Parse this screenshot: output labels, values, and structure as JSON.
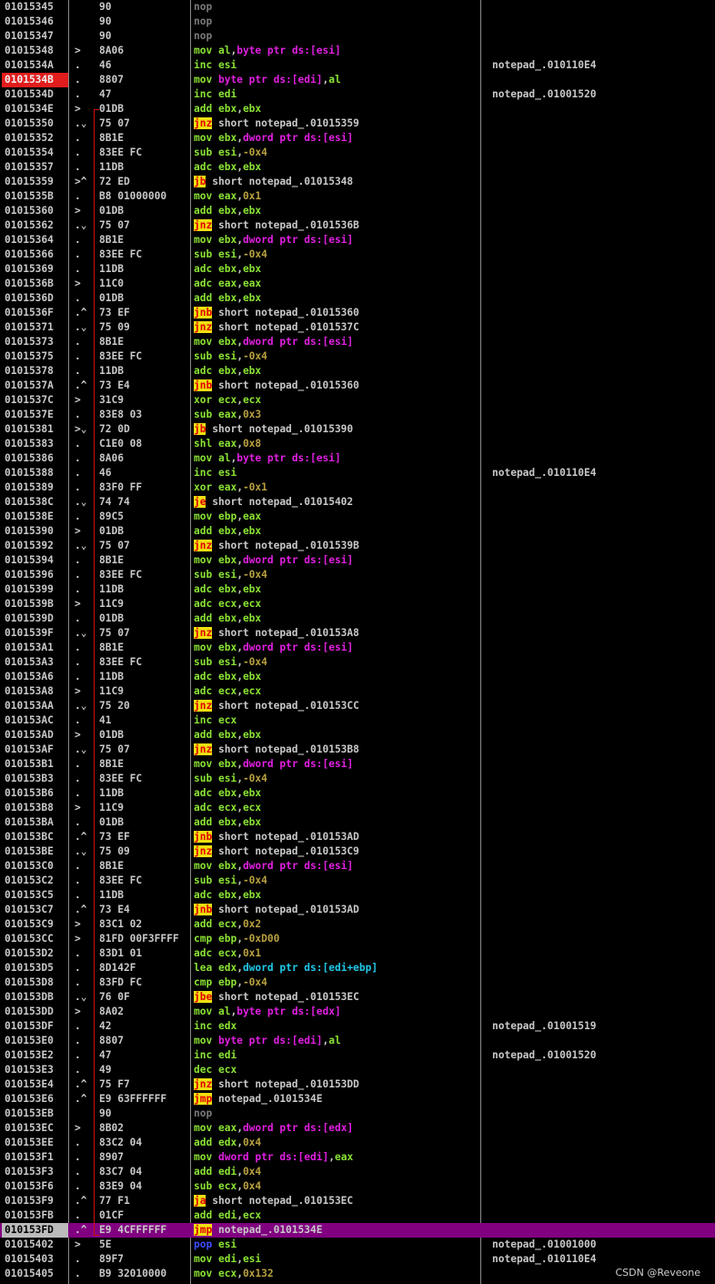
{
  "watermark": "CSDN @Reveone",
  "rows": [
    {
      "addr": "01015345",
      "arrow": "",
      "bytes": "90",
      "mn": "nop",
      "args": "",
      "cmt": ""
    },
    {
      "addr": "01015346",
      "arrow": "",
      "bytes": "90",
      "mn": "nop",
      "args": "",
      "cmt": ""
    },
    {
      "addr": "01015347",
      "arrow": "",
      "bytes": "90",
      "mn": "nop",
      "args": "",
      "cmt": ""
    },
    {
      "addr": "01015348",
      "arrow": ">",
      "bytes": "8A06",
      "mn": "mov",
      "args": "al,byte ptr ds:[esi]",
      "cmt": ""
    },
    {
      "addr": "0101534A",
      "arrow": ".",
      "bytes": "46",
      "mn": "inc",
      "args": "esi",
      "cmt": "notepad_.010110E4"
    },
    {
      "addr": "0101534B",
      "arrow": ".",
      "bytes": "8807",
      "mn": "mov",
      "args": "byte ptr ds:[edi],al",
      "cmt": "",
      "eip": true
    },
    {
      "addr": "0101534D",
      "arrow": ".",
      "bytes": "47",
      "mn": "inc",
      "args": "edi",
      "cmt": "notepad_.01001520"
    },
    {
      "addr": "0101534E",
      "arrow": ">",
      "bytes": "01DB",
      "mn": "add",
      "args": "ebx,ebx",
      "cmt": ""
    },
    {
      "addr": "01015350",
      "arrow": ".⌄",
      "bytes": "75 07",
      "mn": "jnz",
      "args": "short notepad_.01015359",
      "cmt": ""
    },
    {
      "addr": "01015352",
      "arrow": ".",
      "bytes": "8B1E",
      "mn": "mov",
      "args": "ebx,dword ptr ds:[esi]",
      "cmt": ""
    },
    {
      "addr": "01015354",
      "arrow": ".",
      "bytes": "83EE FC",
      "mn": "sub",
      "args": "esi,-0x4",
      "cmt": ""
    },
    {
      "addr": "01015357",
      "arrow": ".",
      "bytes": "11DB",
      "mn": "adc",
      "args": "ebx,ebx",
      "cmt": ""
    },
    {
      "addr": "01015359",
      "arrow": ">^",
      "bytes": "72 ED",
      "mn": "jb",
      "args": "short notepad_.01015348",
      "cmt": ""
    },
    {
      "addr": "0101535B",
      "arrow": ".",
      "bytes": "B8 01000000",
      "mn": "mov",
      "args": "eax,0x1",
      "cmt": ""
    },
    {
      "addr": "01015360",
      "arrow": ">",
      "bytes": "01DB",
      "mn": "add",
      "args": "ebx,ebx",
      "cmt": ""
    },
    {
      "addr": "01015362",
      "arrow": ".⌄",
      "bytes": "75 07",
      "mn": "jnz",
      "args": "short notepad_.0101536B",
      "cmt": ""
    },
    {
      "addr": "01015364",
      "arrow": ".",
      "bytes": "8B1E",
      "mn": "mov",
      "args": "ebx,dword ptr ds:[esi]",
      "cmt": ""
    },
    {
      "addr": "01015366",
      "arrow": ".",
      "bytes": "83EE FC",
      "mn": "sub",
      "args": "esi,-0x4",
      "cmt": ""
    },
    {
      "addr": "01015369",
      "arrow": ".",
      "bytes": "11DB",
      "mn": "adc",
      "args": "ebx,ebx",
      "cmt": ""
    },
    {
      "addr": "0101536B",
      "arrow": ">",
      "bytes": "11C0",
      "mn": "adc",
      "args": "eax,eax",
      "cmt": ""
    },
    {
      "addr": "0101536D",
      "arrow": ".",
      "bytes": "01DB",
      "mn": "add",
      "args": "ebx,ebx",
      "cmt": ""
    },
    {
      "addr": "0101536F",
      "arrow": ".^",
      "bytes": "73 EF",
      "mn": "jnb",
      "args": "short notepad_.01015360",
      "cmt": ""
    },
    {
      "addr": "01015371",
      "arrow": ".⌄",
      "bytes": "75 09",
      "mn": "jnz",
      "args": "short notepad_.0101537C",
      "cmt": ""
    },
    {
      "addr": "01015373",
      "arrow": ".",
      "bytes": "8B1E",
      "mn": "mov",
      "args": "ebx,dword ptr ds:[esi]",
      "cmt": ""
    },
    {
      "addr": "01015375",
      "arrow": ".",
      "bytes": "83EE FC",
      "mn": "sub",
      "args": "esi,-0x4",
      "cmt": ""
    },
    {
      "addr": "01015378",
      "arrow": ".",
      "bytes": "11DB",
      "mn": "adc",
      "args": "ebx,ebx",
      "cmt": ""
    },
    {
      "addr": "0101537A",
      "arrow": ".^",
      "bytes": "73 E4",
      "mn": "jnb",
      "args": "short notepad_.01015360",
      "cmt": ""
    },
    {
      "addr": "0101537C",
      "arrow": ">",
      "bytes": "31C9",
      "mn": "xor",
      "args": "ecx,ecx",
      "cmt": ""
    },
    {
      "addr": "0101537E",
      "arrow": ".",
      "bytes": "83E8 03",
      "mn": "sub",
      "args": "eax,0x3",
      "cmt": ""
    },
    {
      "addr": "01015381",
      "arrow": ">⌄",
      "bytes": "72 0D",
      "mn": "jb",
      "args": "short notepad_.01015390",
      "cmt": ""
    },
    {
      "addr": "01015383",
      "arrow": ".",
      "bytes": "C1E0 08",
      "mn": "shl",
      "args": "eax,0x8",
      "cmt": ""
    },
    {
      "addr": "01015386",
      "arrow": ".",
      "bytes": "8A06",
      "mn": "mov",
      "args": "al,byte ptr ds:[esi]",
      "cmt": ""
    },
    {
      "addr": "01015388",
      "arrow": ".",
      "bytes": "46",
      "mn": "inc",
      "args": "esi",
      "cmt": "notepad_.010110E4"
    },
    {
      "addr": "01015389",
      "arrow": ".",
      "bytes": "83F0 FF",
      "mn": "xor",
      "args": "eax,-0x1",
      "cmt": ""
    },
    {
      "addr": "0101538C",
      "arrow": ".⌄",
      "bytes": "74 74",
      "mn": "je",
      "args": "short notepad_.01015402",
      "cmt": ""
    },
    {
      "addr": "0101538E",
      "arrow": ".",
      "bytes": "89C5",
      "mn": "mov",
      "args": "ebp,eax",
      "cmt": ""
    },
    {
      "addr": "01015390",
      "arrow": ">",
      "bytes": "01DB",
      "mn": "add",
      "args": "ebx,ebx",
      "cmt": ""
    },
    {
      "addr": "01015392",
      "arrow": ".⌄",
      "bytes": "75 07",
      "mn": "jnz",
      "args": "short notepad_.0101539B",
      "cmt": ""
    },
    {
      "addr": "01015394",
      "arrow": ".",
      "bytes": "8B1E",
      "mn": "mov",
      "args": "ebx,dword ptr ds:[esi]",
      "cmt": ""
    },
    {
      "addr": "01015396",
      "arrow": ".",
      "bytes": "83EE FC",
      "mn": "sub",
      "args": "esi,-0x4",
      "cmt": ""
    },
    {
      "addr": "01015399",
      "arrow": ".",
      "bytes": "11DB",
      "mn": "adc",
      "args": "ebx,ebx",
      "cmt": ""
    },
    {
      "addr": "0101539B",
      "arrow": ">",
      "bytes": "11C9",
      "mn": "adc",
      "args": "ecx,ecx",
      "cmt": ""
    },
    {
      "addr": "0101539D",
      "arrow": ".",
      "bytes": "01DB",
      "mn": "add",
      "args": "ebx,ebx",
      "cmt": ""
    },
    {
      "addr": "0101539F",
      "arrow": ".⌄",
      "bytes": "75 07",
      "mn": "jnz",
      "args": "short notepad_.010153A8",
      "cmt": ""
    },
    {
      "addr": "010153A1",
      "arrow": ".",
      "bytes": "8B1E",
      "mn": "mov",
      "args": "ebx,dword ptr ds:[esi]",
      "cmt": ""
    },
    {
      "addr": "010153A3",
      "arrow": ".",
      "bytes": "83EE FC",
      "mn": "sub",
      "args": "esi,-0x4",
      "cmt": ""
    },
    {
      "addr": "010153A6",
      "arrow": ".",
      "bytes": "11DB",
      "mn": "adc",
      "args": "ebx,ebx",
      "cmt": ""
    },
    {
      "addr": "010153A8",
      "arrow": ">",
      "bytes": "11C9",
      "mn": "adc",
      "args": "ecx,ecx",
      "cmt": ""
    },
    {
      "addr": "010153AA",
      "arrow": ".⌄",
      "bytes": "75 20",
      "mn": "jnz",
      "args": "short notepad_.010153CC",
      "cmt": ""
    },
    {
      "addr": "010153AC",
      "arrow": ".",
      "bytes": "41",
      "mn": "inc",
      "args": "ecx",
      "cmt": ""
    },
    {
      "addr": "010153AD",
      "arrow": ">",
      "bytes": "01DB",
      "mn": "add",
      "args": "ebx,ebx",
      "cmt": ""
    },
    {
      "addr": "010153AF",
      "arrow": ".⌄",
      "bytes": "75 07",
      "mn": "jnz",
      "args": "short notepad_.010153B8",
      "cmt": ""
    },
    {
      "addr": "010153B1",
      "arrow": ".",
      "bytes": "8B1E",
      "mn": "mov",
      "args": "ebx,dword ptr ds:[esi]",
      "cmt": ""
    },
    {
      "addr": "010153B3",
      "arrow": ".",
      "bytes": "83EE FC",
      "mn": "sub",
      "args": "esi,-0x4",
      "cmt": ""
    },
    {
      "addr": "010153B6",
      "arrow": ".",
      "bytes": "11DB",
      "mn": "adc",
      "args": "ebx,ebx",
      "cmt": ""
    },
    {
      "addr": "010153B8",
      "arrow": ">",
      "bytes": "11C9",
      "mn": "adc",
      "args": "ecx,ecx",
      "cmt": ""
    },
    {
      "addr": "010153BA",
      "arrow": ".",
      "bytes": "01DB",
      "mn": "add",
      "args": "ebx,ebx",
      "cmt": ""
    },
    {
      "addr": "010153BC",
      "arrow": ".^",
      "bytes": "73 EF",
      "mn": "jnb",
      "args": "short notepad_.010153AD",
      "cmt": ""
    },
    {
      "addr": "010153BE",
      "arrow": ".⌄",
      "bytes": "75 09",
      "mn": "jnz",
      "args": "short notepad_.010153C9",
      "cmt": ""
    },
    {
      "addr": "010153C0",
      "arrow": ".",
      "bytes": "8B1E",
      "mn": "mov",
      "args": "ebx,dword ptr ds:[esi]",
      "cmt": ""
    },
    {
      "addr": "010153C2",
      "arrow": ".",
      "bytes": "83EE FC",
      "mn": "sub",
      "args": "esi,-0x4",
      "cmt": ""
    },
    {
      "addr": "010153C5",
      "arrow": ".",
      "bytes": "11DB",
      "mn": "adc",
      "args": "ebx,ebx",
      "cmt": ""
    },
    {
      "addr": "010153C7",
      "arrow": ".^",
      "bytes": "73 E4",
      "mn": "jnb",
      "args": "short notepad_.010153AD",
      "cmt": ""
    },
    {
      "addr": "010153C9",
      "arrow": ">",
      "bytes": "83C1 02",
      "mn": "add",
      "args": "ecx,0x2",
      "cmt": ""
    },
    {
      "addr": "010153CC",
      "arrow": ">",
      "bytes": "81FD 00F3FFFF",
      "mn": "cmp",
      "args": "ebp,-0xD00",
      "cmt": ""
    },
    {
      "addr": "010153D2",
      "arrow": ".",
      "bytes": "83D1 01",
      "mn": "adc",
      "args": "ecx,0x1",
      "cmt": ""
    },
    {
      "addr": "010153D5",
      "arrow": ".",
      "bytes": "8D142F",
      "mn": "lea",
      "args": "edx,dword ptr ds:[edi+ebp]",
      "cmt": ""
    },
    {
      "addr": "010153D8",
      "arrow": ".",
      "bytes": "83FD FC",
      "mn": "cmp",
      "args": "ebp,-0x4",
      "cmt": ""
    },
    {
      "addr": "010153DB",
      "arrow": ".⌄",
      "bytes": "76 0F",
      "mn": "jbe",
      "args": "short notepad_.010153EC",
      "cmt": ""
    },
    {
      "addr": "010153DD",
      "arrow": ">",
      "bytes": "8A02",
      "mn": "mov",
      "args": "al,byte ptr ds:[edx]",
      "cmt": ""
    },
    {
      "addr": "010153DF",
      "arrow": ".",
      "bytes": "42",
      "mn": "inc",
      "args": "edx",
      "cmt": "notepad_.01001519"
    },
    {
      "addr": "010153E0",
      "arrow": ".",
      "bytes": "8807",
      "mn": "mov",
      "args": "byte ptr ds:[edi],al",
      "cmt": ""
    },
    {
      "addr": "010153E2",
      "arrow": ".",
      "bytes": "47",
      "mn": "inc",
      "args": "edi",
      "cmt": "notepad_.01001520"
    },
    {
      "addr": "010153E3",
      "arrow": ".",
      "bytes": "49",
      "mn": "dec",
      "args": "ecx",
      "cmt": ""
    },
    {
      "addr": "010153E4",
      "arrow": ".^",
      "bytes": "75 F7",
      "mn": "jnz",
      "args": "short notepad_.010153DD",
      "cmt": ""
    },
    {
      "addr": "010153E6",
      "arrow": ".^",
      "bytes": "E9 63FFFFFF",
      "mn": "jmp",
      "args": "notepad_.0101534E",
      "cmt": ""
    },
    {
      "addr": "010153EB",
      "arrow": "",
      "bytes": "90",
      "mn": "nop",
      "args": "",
      "cmt": ""
    },
    {
      "addr": "010153EC",
      "arrow": ">",
      "bytes": "8B02",
      "mn": "mov",
      "args": "eax,dword ptr ds:[edx]",
      "cmt": ""
    },
    {
      "addr": "010153EE",
      "arrow": ".",
      "bytes": "83C2 04",
      "mn": "add",
      "args": "edx,0x4",
      "cmt": ""
    },
    {
      "addr": "010153F1",
      "arrow": ".",
      "bytes": "8907",
      "mn": "mov",
      "args": "dword ptr ds:[edi],eax",
      "cmt": ""
    },
    {
      "addr": "010153F3",
      "arrow": ".",
      "bytes": "83C7 04",
      "mn": "add",
      "args": "edi,0x4",
      "cmt": ""
    },
    {
      "addr": "010153F6",
      "arrow": ".",
      "bytes": "83E9 04",
      "mn": "sub",
      "args": "ecx,0x4",
      "cmt": ""
    },
    {
      "addr": "010153F9",
      "arrow": ".^",
      "bytes": "77 F1",
      "mn": "ja",
      "args": "short notepad_.010153EC",
      "cmt": ""
    },
    {
      "addr": "010153FB",
      "arrow": ".",
      "bytes": "01CF",
      "mn": "add",
      "args": "edi,ecx",
      "cmt": ""
    },
    {
      "addr": "010153FD",
      "arrow": ".^",
      "bytes": "E9 4CFFFFFF",
      "mn": "jmp",
      "args": "notepad_.0101534E",
      "cmt": "",
      "sel": true
    },
    {
      "addr": "01015402",
      "arrow": ">",
      "bytes": "5E",
      "mn": "pop",
      "args": "esi",
      "cmt": "notepad_.01001000"
    },
    {
      "addr": "01015403",
      "arrow": ".",
      "bytes": "89F7",
      "mn": "mov",
      "args": "edi,esi",
      "cmt": "notepad_.010110E4"
    },
    {
      "addr": "01015405",
      "arrow": ".",
      "bytes": "B9 32010000",
      "mn": "mov",
      "args": "ecx,0x132",
      "cmt": ""
    }
  ]
}
